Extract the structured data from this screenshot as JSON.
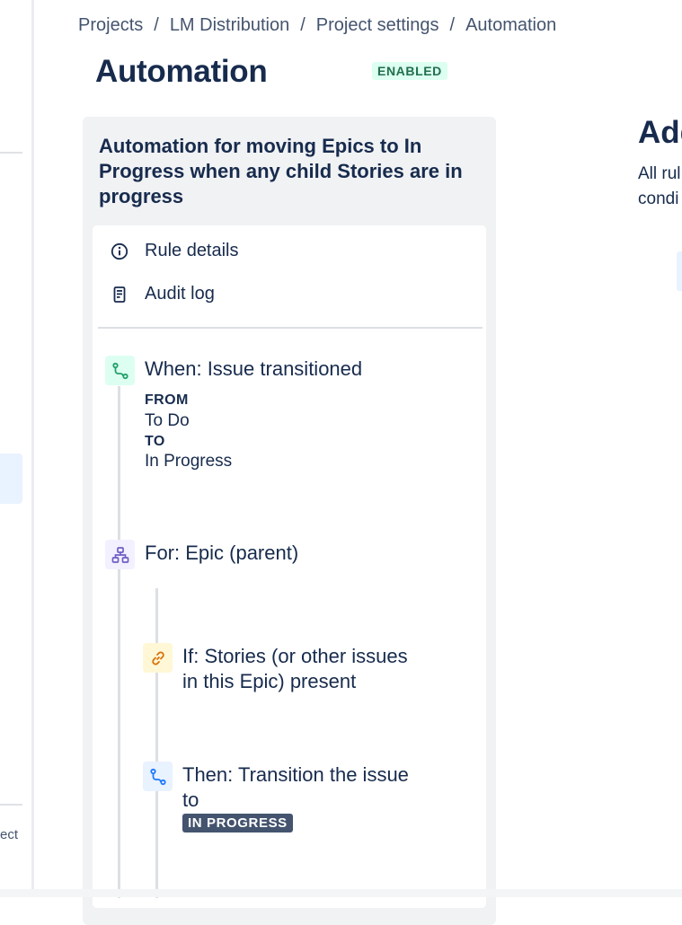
{
  "breadcrumb": {
    "items": [
      "Projects",
      "LM Distribution",
      "Project settings",
      "Automation"
    ],
    "separator": "/"
  },
  "page": {
    "title": "Automation",
    "status_badge": "ENABLED"
  },
  "left_nav": {
    "partial_label": "ect"
  },
  "rule": {
    "title": "Automation for moving Epics to In Progress when any child Stories are in progress",
    "menu": [
      {
        "label": "Rule details",
        "icon": "info-icon"
      },
      {
        "label": "Audit log",
        "icon": "document-icon"
      }
    ],
    "components": {
      "trigger": {
        "title": "When: Issue transitioned",
        "from_label": "FROM",
        "from_value": "To Do",
        "to_label": "TO",
        "to_value": "In Progress",
        "icon": "transition-icon",
        "color": "#22a06b"
      },
      "branch": {
        "title": "For: Epic (parent)",
        "icon": "hierarchy-icon",
        "color": "#6e5dc6"
      },
      "condition": {
        "title_line1": "If: Stories (or other issues",
        "title_line2": "in this Epic) present",
        "icon": "link-icon",
        "color": "#d97008"
      },
      "action": {
        "title_line1": "Then: Transition the issue",
        "title_line2": "to",
        "status_lozenge": "IN PROGRESS",
        "icon": "transition-icon",
        "color": "#1d7afc"
      }
    }
  },
  "right_panel": {
    "heading": "Add",
    "desc_line1": "All rul",
    "desc_line2": "condi"
  },
  "colors": {
    "text": "#172b4d",
    "panel_bg": "#f1f2f4",
    "badge_bg": "#dcfff1",
    "badge_text": "#216e4e",
    "lozenge_bg": "#44546f"
  }
}
